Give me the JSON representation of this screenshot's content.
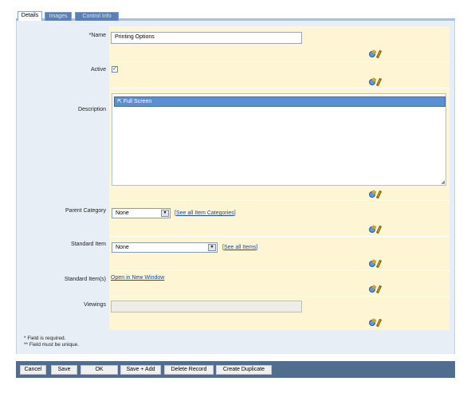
{
  "tabs": [
    {
      "label": "Details",
      "active": true
    },
    {
      "label": "Images",
      "active": false
    },
    {
      "label": "Control Info",
      "active": false
    }
  ],
  "fields": {
    "name": {
      "label": "*Name",
      "value": "Printing Options"
    },
    "active": {
      "label": "Active",
      "checked": true,
      "check_glyph": "✓"
    },
    "description": {
      "label": "Description",
      "item": "Full Screen",
      "item_icon": "⇱",
      "resize_glyph": "◢"
    },
    "parent_category": {
      "label": "Parent Category",
      "value": "None",
      "link_text": "See all Item Categories"
    },
    "standard_item": {
      "label": "Standard Item",
      "value": "None",
      "link_text": "See all Items"
    },
    "standard_items": {
      "label": "Standard Item(s)",
      "link_text": "Open in New Window"
    },
    "viewings": {
      "label": "Viewings",
      "value": ""
    }
  },
  "bracket_open": "[",
  "bracket_close": "]",
  "dropdown_glyph": "▼",
  "icons": {
    "row_action_1": "gear-wrench-icon",
    "row_action_2": "pencil-icon"
  },
  "notes": {
    "required": "* Field is required.",
    "unique": "** Field must be unique."
  },
  "buttons": {
    "cancel": "Cancel",
    "save": "Save",
    "ok": "OK",
    "save_add": "Save + Add",
    "delete": "Delete Record",
    "duplicate": "Create Duplicate"
  },
  "colors": {
    "form_bg": "#fdf5d4",
    "panel_bg": "#e8eef6",
    "button_bar": "#506d90",
    "tab_inactive": "#5b7fb8",
    "selection": "#5b8fd4"
  }
}
